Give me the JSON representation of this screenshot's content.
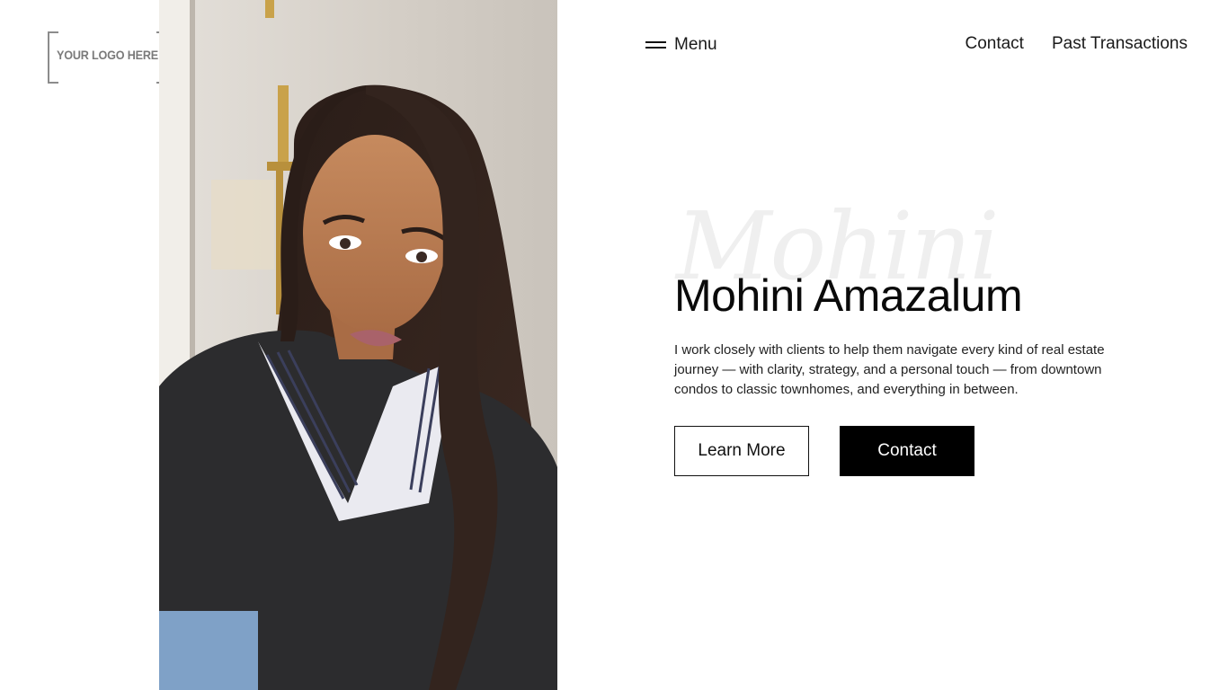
{
  "logo": {
    "text": "YOUR LOGO HERE"
  },
  "header": {
    "menu_label": "Menu",
    "nav": [
      {
        "label": "Contact"
      },
      {
        "label": "Past Transactions"
      }
    ]
  },
  "hero": {
    "script_watermark": "Mohini",
    "name": "Mohini Amazalum",
    "description": "I work closely with clients to help them navigate every kind of real estate journey — with clarity, strategy, and a personal touch — from downtown condos to classic townhomes, and everything in between.",
    "buttons": {
      "learn_more": "Learn More",
      "contact": "Contact"
    }
  },
  "colors": {
    "background": "#ffffff",
    "text": "#111111",
    "button_solid_bg": "#000000",
    "button_solid_text": "#ffffff",
    "watermark": "#efefef"
  },
  "icons": {
    "menu": "hamburger-icon"
  }
}
